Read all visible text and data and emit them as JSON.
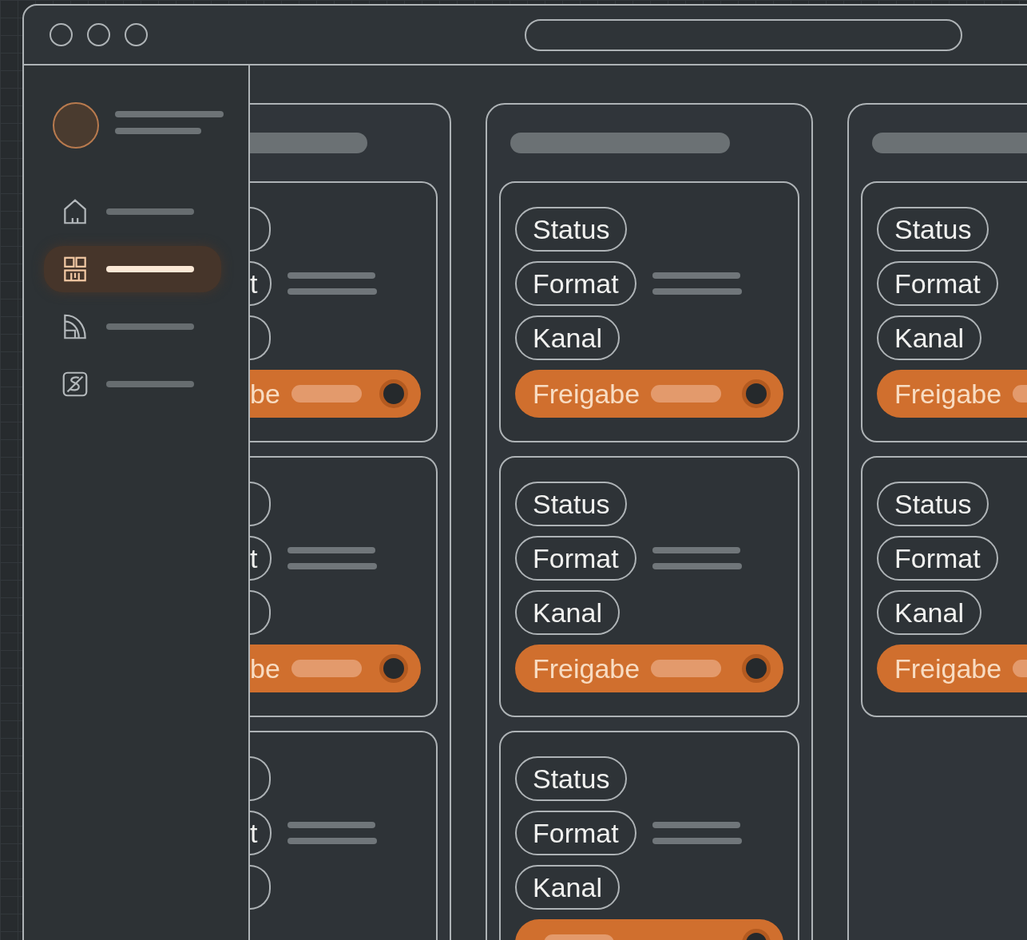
{
  "sidebar": {
    "items": [
      {
        "kind": "home",
        "selected": false
      },
      {
        "kind": "grid",
        "selected": true
      },
      {
        "kind": "document",
        "selected": false
      },
      {
        "kind": "badge",
        "selected": false
      }
    ]
  },
  "board": {
    "columns": [
      {
        "clipped": true,
        "cards": [
          {
            "lines": true,
            "tags": [
              {
                "clipped": true
              },
              {
                "clipped": true,
                "label": "t"
              },
              {
                "clipped": true
              }
            ],
            "toggle": {
              "label": "be",
              "on": true
            }
          },
          {
            "lines": true,
            "tags": [
              {
                "clipped": true
              },
              {
                "clipped": true,
                "label": "t"
              },
              {
                "clipped": true
              }
            ],
            "toggle": {
              "label": "be",
              "on": true
            }
          },
          {
            "lines": true,
            "tags": [
              {
                "clipped": true
              },
              {
                "clipped": true,
                "label": "t"
              },
              {
                "clipped": true
              }
            ]
          }
        ]
      },
      {
        "clipped": false,
        "cards": [
          {
            "lines": true,
            "tags": [
              {
                "label": "Status"
              },
              {
                "label": "Format"
              },
              {
                "label": "Kanal"
              }
            ],
            "toggle": {
              "label": "Freigabe",
              "on": true
            }
          },
          {
            "lines": true,
            "tags": [
              {
                "label": "Status"
              },
              {
                "label": "Format"
              },
              {
                "label": "Kanal"
              }
            ],
            "toggle": {
              "label": "Freigabe",
              "on": true
            }
          },
          {
            "lines": true,
            "tags": [
              {
                "label": "Status"
              },
              {
                "label": "Format"
              },
              {
                "label": "Kanal"
              }
            ],
            "toggle": {
              "on": true
            }
          }
        ]
      },
      {
        "clipped": false,
        "cards": [
          {
            "lines": false,
            "tags": [
              {
                "label": "Status"
              },
              {
                "label": "Format"
              },
              {
                "label": "Kanal"
              }
            ],
            "toggle": {
              "label": "Freigabe",
              "on": true
            }
          },
          {
            "lines": false,
            "tags": [
              {
                "label": "Status"
              },
              {
                "label": "Format"
              },
              {
                "label": "Kanal"
              }
            ],
            "toggle": {
              "label": "Freigabe",
              "on": true
            }
          }
        ]
      }
    ]
  }
}
